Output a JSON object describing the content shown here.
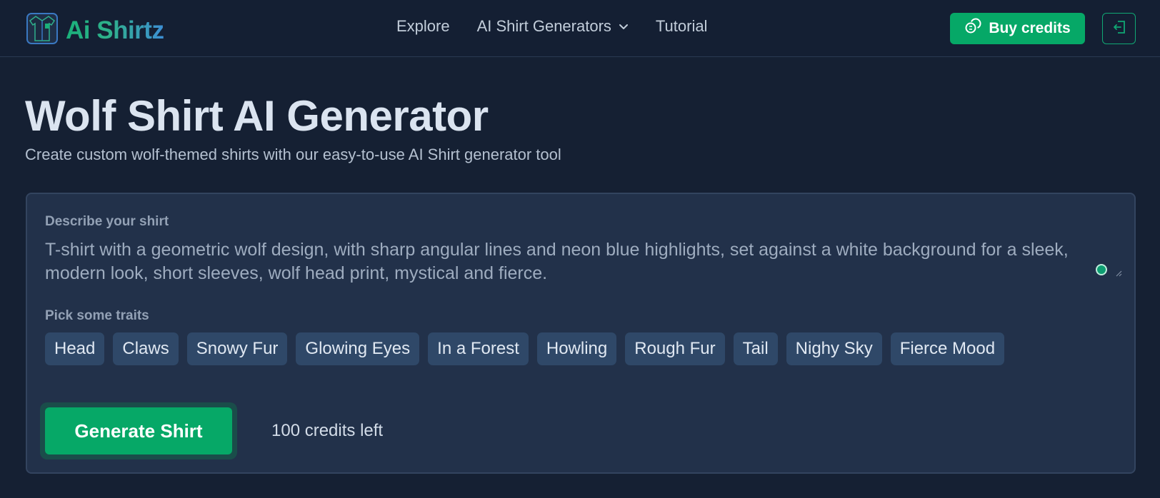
{
  "header": {
    "logo_text": "Ai Shirtz",
    "logo_icon": "shirt-logo-icon",
    "nav": [
      {
        "label": "Explore"
      },
      {
        "label": "AI Shirt Generators",
        "icon": "chevron-down-icon"
      },
      {
        "label": "Tutorial"
      }
    ],
    "buy_credits_label": "Buy credits",
    "buy_credits_icon": "coins-icon",
    "logout_icon": "logout-icon"
  },
  "page": {
    "title": "Wolf Shirt AI Generator",
    "subtitle": "Create custom wolf-themed shirts with our easy-to-use AI Shirt generator tool"
  },
  "form": {
    "describe_label": "Describe your shirt",
    "description_value": "T-shirt with a geometric wolf design, with sharp angular lines and neon blue highlights, set against a white background for a sleek, modern look, short sleeves, wolf head print, mystical and fierce.",
    "traits_label": "Pick some traits",
    "traits": [
      "Head",
      "Claws",
      "Snowy Fur",
      "Glowing Eyes",
      "In a Forest",
      "Howling",
      "Rough Fur",
      "Tail",
      "Nighy Sky",
      "Fierce Mood"
    ],
    "generate_label": "Generate Shirt",
    "credits_left": "100 credits left"
  },
  "colors": {
    "background": "#152033",
    "card": "#22314a",
    "accent_green": "#06a867",
    "chip": "#2f4868"
  }
}
